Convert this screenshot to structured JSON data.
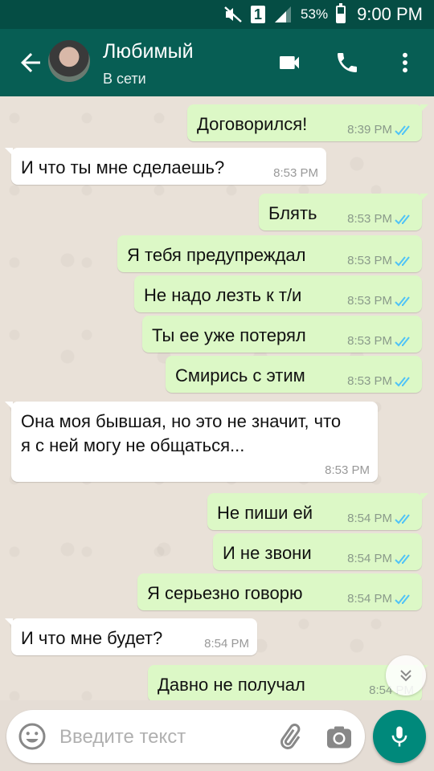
{
  "status_bar": {
    "battery_percent": "53%",
    "battery_level": 0.53,
    "time": "9:00 PM",
    "sim_label": "1",
    "icons": [
      "mute-icon",
      "sim-icon",
      "signal-icon",
      "battery-icon"
    ]
  },
  "header": {
    "contact_name": "Любимый",
    "contact_status": "В сети",
    "icons": [
      "back-arrow-icon",
      "video-call-icon",
      "phone-call-icon",
      "more-vertical-icon"
    ]
  },
  "messages": [
    {
      "dir": "out",
      "text": "Договорился!",
      "time": "8:39 PM",
      "read": true
    },
    {
      "dir": "in",
      "text": "И что ты мне сделаешь?",
      "time": "8:53 PM"
    },
    {
      "dir": "out",
      "text": "Блять",
      "time": "8:53 PM",
      "read": true
    },
    {
      "dir": "out",
      "text": "Я тебя предупреждал",
      "time": "8:53 PM",
      "read": true
    },
    {
      "dir": "out",
      "text": "Не надо лезть к т/и",
      "time": "8:53 PM",
      "read": true
    },
    {
      "dir": "out",
      "text": "Ты ее уже потерял",
      "time": "8:53 PM",
      "read": true
    },
    {
      "dir": "out",
      "text": "Смирись с этим",
      "time": "8:53 PM",
      "read": true
    },
    {
      "dir": "in",
      "text": "Она моя бывшая, но это не значит, что я с ней могу не общаться...",
      "time": "8:53 PM"
    },
    {
      "dir": "out",
      "text": "Не пиши ей",
      "time": "8:54 PM",
      "read": true
    },
    {
      "dir": "out",
      "text": "И не звони",
      "time": "8:54 PM",
      "read": true
    },
    {
      "dir": "out",
      "text": "Я серьезно говорю",
      "time": "8:54 PM",
      "read": true
    },
    {
      "dir": "in",
      "text": "И что мне будет?",
      "time": "8:54 PM"
    },
    {
      "dir": "out",
      "text": "Давно не получал",
      "time": "8:54 PM",
      "read": false
    }
  ],
  "composer": {
    "placeholder": "Введите текст",
    "value": ""
  },
  "colors": {
    "header": "#075e54",
    "status_bar": "#054d44",
    "outgoing_bubble": "#dcf8c6",
    "incoming_bubble": "#ffffff",
    "read_ticks": "#4fc3f7",
    "mic_button": "#00897b"
  }
}
